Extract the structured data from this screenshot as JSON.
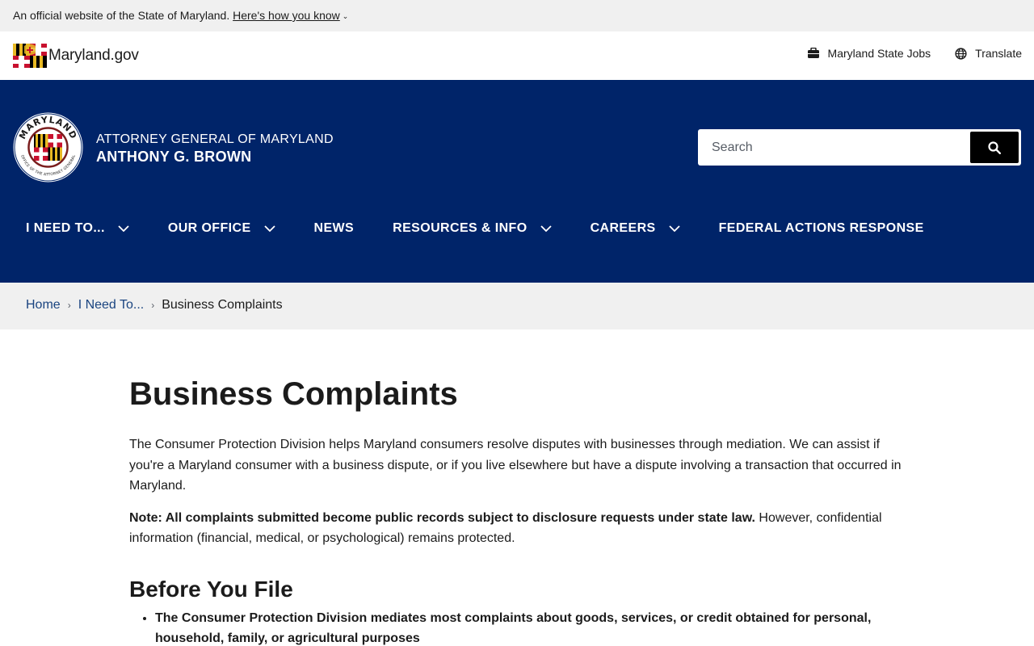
{
  "banner": {
    "text": "An official website of the State of Maryland.",
    "link": "Here's how you know"
  },
  "utility": {
    "logo_text": "Maryland.gov",
    "jobs_label": "Maryland State Jobs",
    "translate_label": "Translate"
  },
  "header": {
    "agency_line1": "ATTORNEY GENERAL OF MARYLAND",
    "agency_line2": "ANTHONY G. BROWN",
    "seal_top_text": "MARYLAND",
    "seal_bottom_text": "OFFICE OF THE ATTORNEY GENERAL",
    "search_placeholder": "Search"
  },
  "nav": {
    "items": [
      {
        "label": "I NEED TO...",
        "has_dropdown": true
      },
      {
        "label": "OUR OFFICE",
        "has_dropdown": true
      },
      {
        "label": "NEWS",
        "has_dropdown": false
      },
      {
        "label": "RESOURCES & INFO",
        "has_dropdown": true
      },
      {
        "label": "CAREERS",
        "has_dropdown": true
      },
      {
        "label": "FEDERAL ACTIONS RESPONSE",
        "has_dropdown": false
      }
    ]
  },
  "breadcrumb": {
    "home": "Home",
    "parent": "I Need To...",
    "current": "Business Complaints"
  },
  "main": {
    "title": "Business Complaints",
    "intro": "The Consumer Protection Division helps Maryland consumers resolve disputes with businesses through mediation. We can assist if you're a Maryland consumer with a business dispute, or if you live elsewhere but have a dispute involving a transaction that occurred in Maryland.",
    "note_bold": "Note: All complaints submitted become public records subject to disclosure requests under state law.",
    "note_rest": " However, confidential information (financial, medical, or psychological) remains protected.",
    "section_title": "Before You File",
    "bullets": [
      "The Consumer Protection Division mediates most complaints about goods, services, or credit obtained for personal, household, family, or agricultural purposes"
    ]
  },
  "colors": {
    "header_bg": "#002469",
    "banner_bg": "#f0f0f0",
    "link": "#1a4480"
  }
}
